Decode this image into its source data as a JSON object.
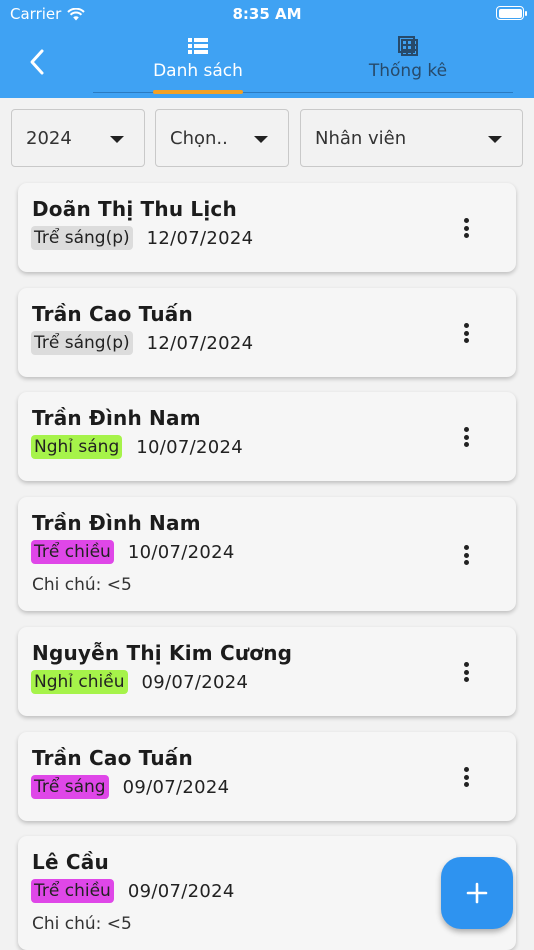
{
  "status_bar": {
    "carrier": "Carrier",
    "time": "8:35 AM"
  },
  "header": {
    "tabs": [
      {
        "label": "Danh sách",
        "icon": "list-icon",
        "active": true
      },
      {
        "label": "Thống kê",
        "icon": "table-chart-icon",
        "active": false
      }
    ],
    "accent_color": "#3fa2f3",
    "indicator_color": "#f3a125"
  },
  "filters": {
    "year": "2024",
    "month": "Chọn..",
    "staff": "Nhân viên"
  },
  "records": [
    {
      "name": "Doãn Thị Thu Lịch",
      "type": "Trể sáng(p)",
      "color": "gray",
      "date": "12/07/2024",
      "note": ""
    },
    {
      "name": "Trần Cao Tuấn",
      "type": "Trể sáng(p)",
      "color": "gray",
      "date": "12/07/2024",
      "note": ""
    },
    {
      "name": "Trần Đình Nam",
      "type": "Nghỉ sáng",
      "color": "green",
      "date": "10/07/2024",
      "note": ""
    },
    {
      "name": "Trần Đình Nam",
      "type": "Trể chiều",
      "color": "magenta",
      "date": "10/07/2024",
      "note": "Chi chú: <5"
    },
    {
      "name": "Nguyễn Thị Kim Cương",
      "type": "Nghỉ chiều",
      "color": "green",
      "date": "09/07/2024",
      "note": ""
    },
    {
      "name": "Trần Cao Tuấn",
      "type": "Trể sáng",
      "color": "magenta",
      "date": "09/07/2024",
      "note": ""
    },
    {
      "name": "Lê Cầu",
      "type": "Trể chiều",
      "color": "magenta",
      "date": "09/07/2024",
      "note": "Chi chú: <5"
    }
  ],
  "fab": {
    "icon": "plus-icon"
  }
}
